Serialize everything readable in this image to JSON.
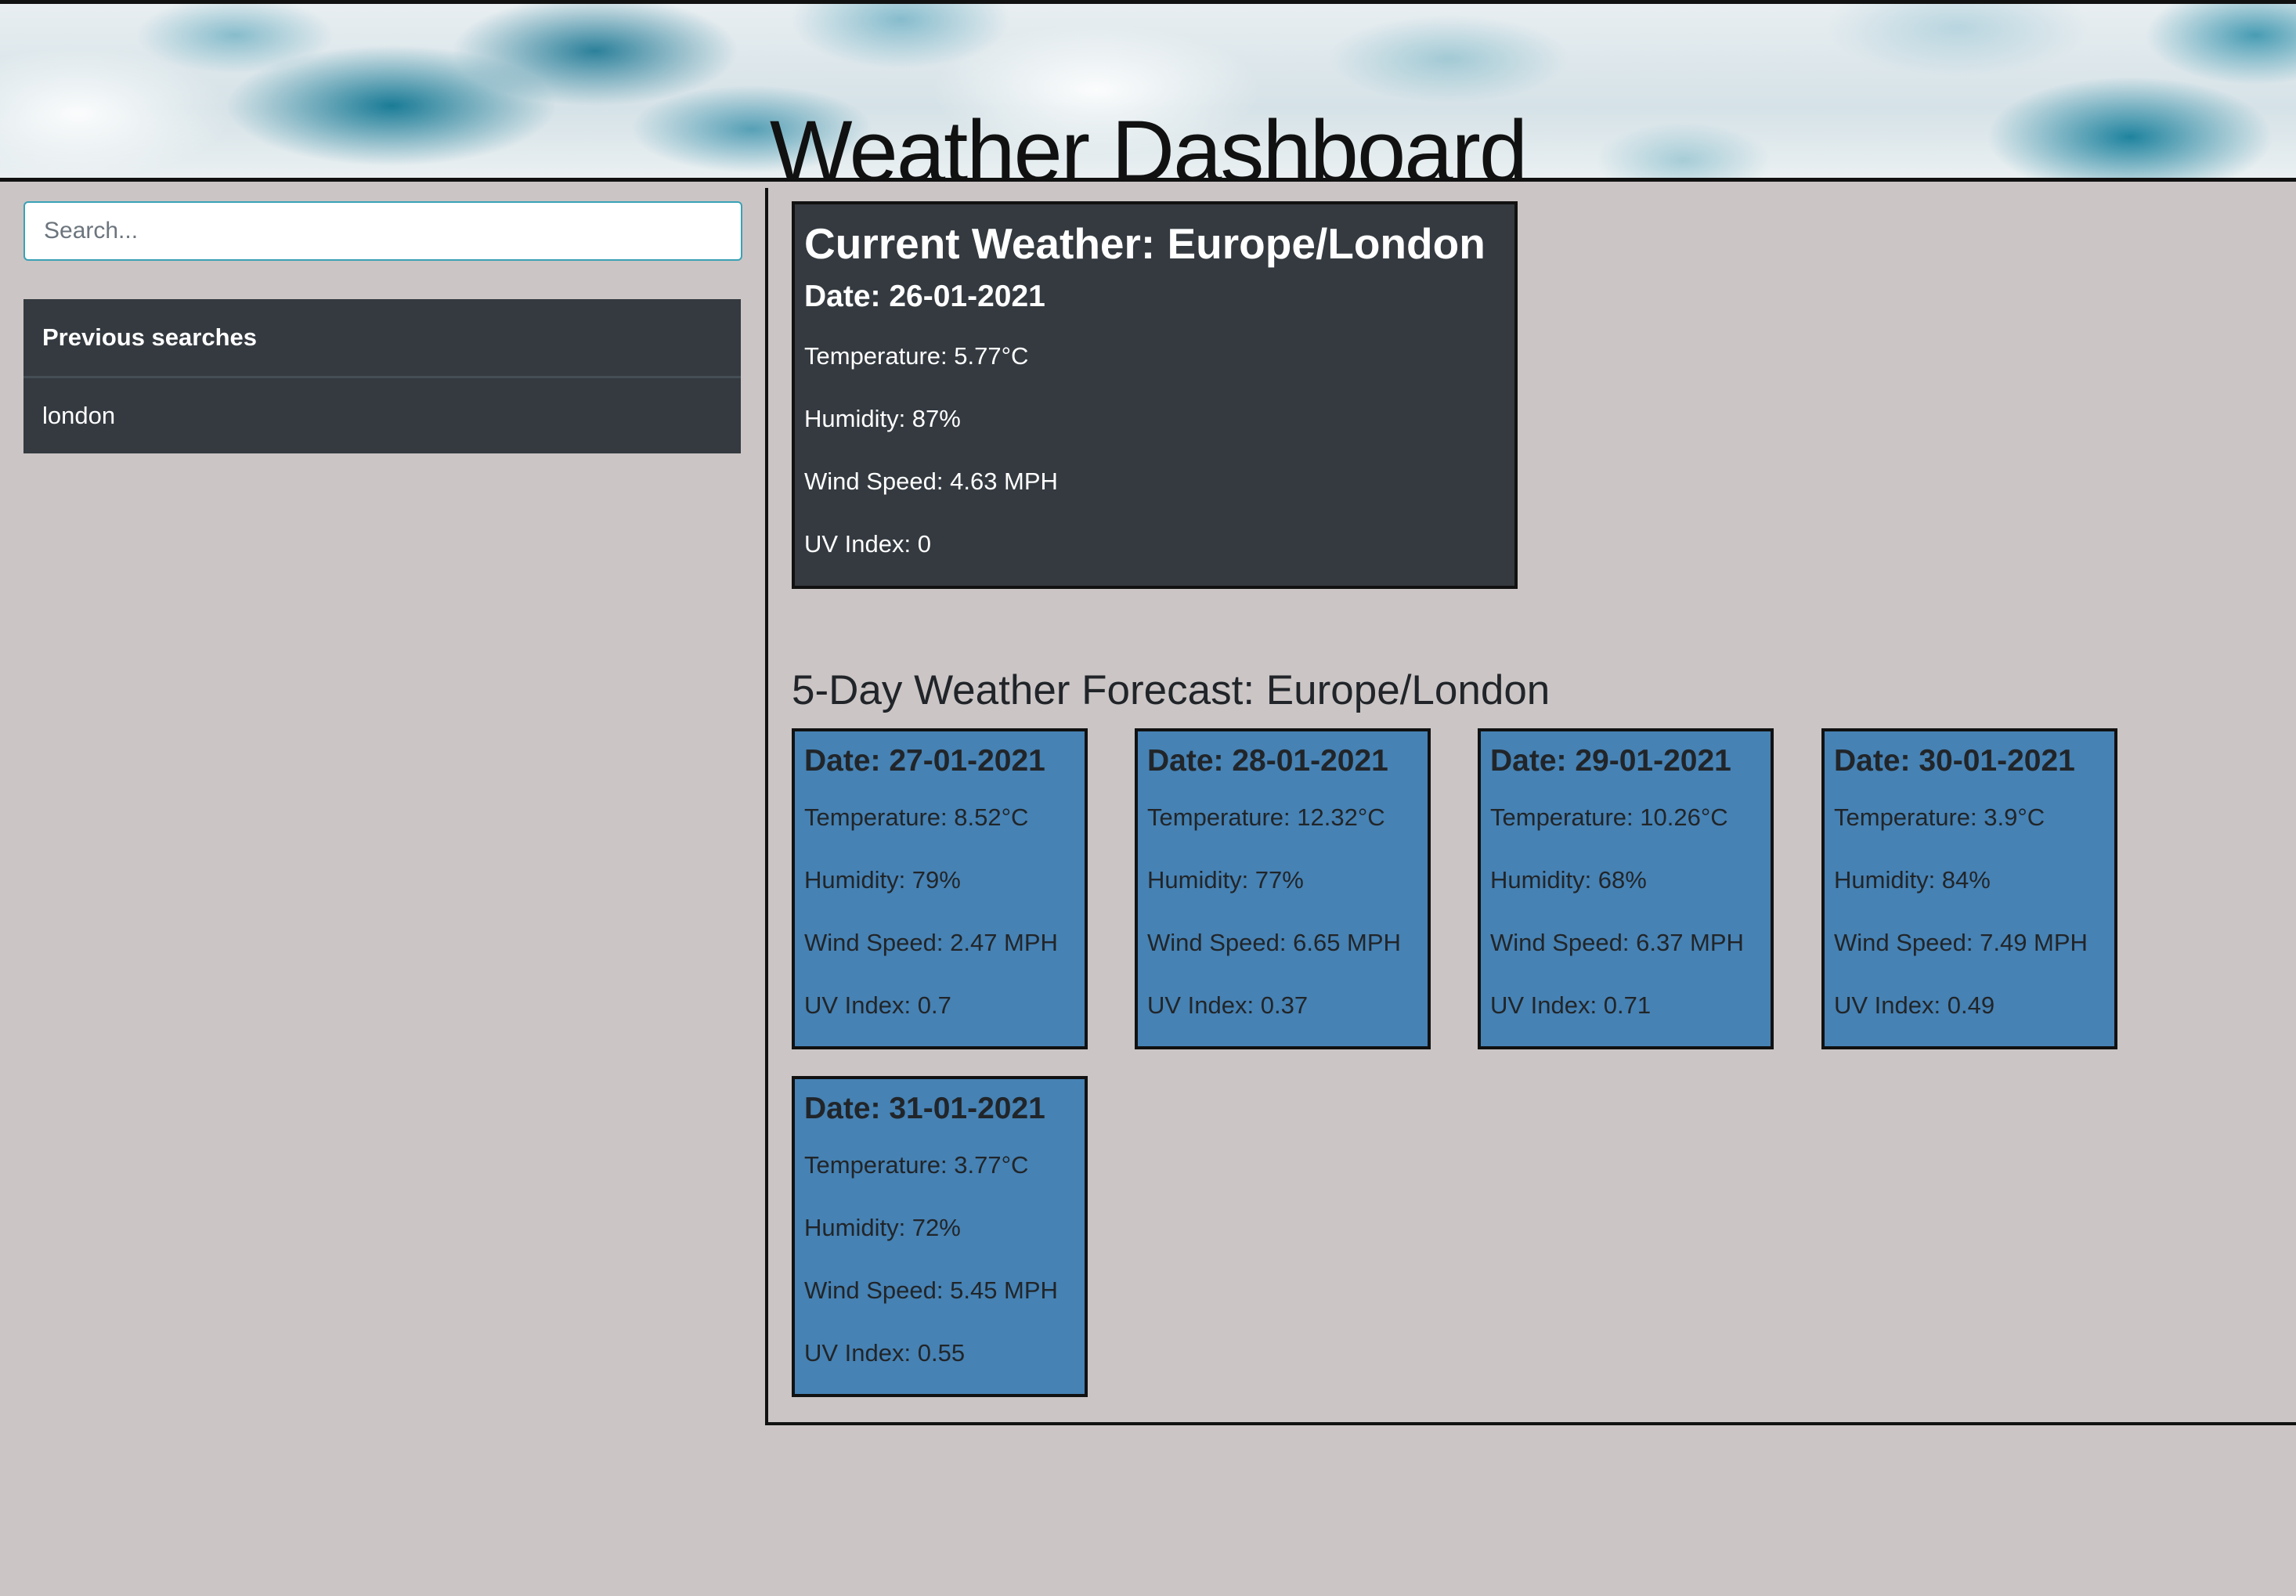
{
  "header": {
    "title": "Weather Dashboard"
  },
  "sidebar": {
    "search_placeholder": "Search...",
    "previous_searches_title": "Previous searches",
    "previous_searches": [
      "london"
    ]
  },
  "current": {
    "title": "Current Weather: Europe/London",
    "date": "Date: 26-01-2021",
    "temperature": "Temperature: 5.77°C",
    "humidity": "Humidity: 87%",
    "wind": "Wind Speed: 4.63 MPH",
    "uv": "UV Index: 0"
  },
  "forecast": {
    "title": "5-Day Weather Forecast: Europe/London",
    "days": [
      {
        "date": "Date: 27-01-2021",
        "temperature": "Temperature: 8.52°C",
        "humidity": "Humidity: 79%",
        "wind": "Wind Speed: 2.47 MPH",
        "uv": "UV Index: 0.7"
      },
      {
        "date": "Date: 28-01-2021",
        "temperature": "Temperature: 12.32°C",
        "humidity": "Humidity: 77%",
        "wind": "Wind Speed: 6.65 MPH",
        "uv": "UV Index: 0.37"
      },
      {
        "date": "Date: 29-01-2021",
        "temperature": "Temperature: 10.26°C",
        "humidity": "Humidity: 68%",
        "wind": "Wind Speed: 6.37 MPH",
        "uv": "UV Index: 0.71"
      },
      {
        "date": "Date: 30-01-2021",
        "temperature": "Temperature: 3.9°C",
        "humidity": "Humidity: 84%",
        "wind": "Wind Speed: 7.49 MPH",
        "uv": "UV Index: 0.49"
      },
      {
        "date": "Date: 31-01-2021",
        "temperature": "Temperature: 3.77°C",
        "humidity": "Humidity: 72%",
        "wind": "Wind Speed: 5.45 MPH",
        "uv": "UV Index: 0.55"
      }
    ]
  },
  "colors": {
    "page_background": "#cbc5c5",
    "current_card": "#343a40",
    "forecast_card": "#4682b4",
    "search_border": "#3aa1b5"
  }
}
